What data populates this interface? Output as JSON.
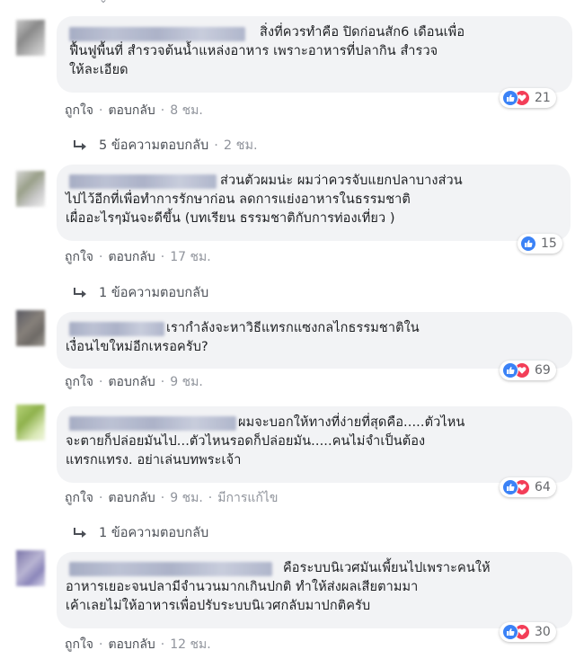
{
  "comments": [
    {
      "text": "สิ่งที่ควรทำคือ ปิดก่อนสัก6 เดือนเพื่อ\nฟื้นฟูพื้นที่ สำรวจต้นน้ำแหล่งอาหาร เพราะอาหารที่ปลากิน สำรวจ\nให้ละเอียด",
      "reaction_count": "21",
      "reactions": [
        "like",
        "love"
      ],
      "like_label": "ถูกใจ",
      "reply_label": "ตอบกลับ",
      "time": "8 ชม.",
      "replies_label": "5 ข้อความตอบกลับ",
      "replies_time": "2 ชม."
    },
    {
      "text": "ส่วนตัวผมน่ะ ผมว่าควรจับแยกปลาบางส่วน\nไปไว้อีกที่เพื่อทำการรักษาก่อน ลดการแย่งอาหารในธรรมชาติ\nเผื่ออะไรๆมันจะดีขึ้น (บทเรียน ธรรมชาติกับการท่องเที่ยว )",
      "reaction_count": "15",
      "reactions": [
        "like"
      ],
      "like_label": "ถูกใจ",
      "reply_label": "ตอบกลับ",
      "time": "17 ชม.",
      "replies_label": "1 ข้อความตอบกลับ"
    },
    {
      "text": "เรากำลังจะหาวิธีแทรกแซงกลไกธรรมชาติใน\nเงื่อนไขใหม่อีกเหรอครับ?",
      "reaction_count": "69",
      "reactions": [
        "like",
        "love"
      ],
      "like_label": "ถูกใจ",
      "reply_label": "ตอบกลับ",
      "time": "9 ชม."
    },
    {
      "text": "ผมจะบอกให้ทางที่ง่ายที่สุดคือ.....ตัวไหน\nจะตายก็ปล่อยมันไป...ตัวไหนรอดก็ปล่อยมัน.....คนไม่จำเป็นต้อง\nแทรกแทรง. อย่าเล่นบทพระเจ้า",
      "reaction_count": "64",
      "reactions": [
        "like",
        "love"
      ],
      "like_label": "ถูกใจ",
      "reply_label": "ตอบกลับ",
      "time": "9 ชม.",
      "edited_label": "มีการแก้ไข",
      "replies_label": "1 ข้อความตอบกลับ"
    },
    {
      "text": "คือระบบนิเวศมันเพี้ยนไปเพราะคนให้\nอาหารเยอะจนปลามีจำนวนมากเกินปกติ ทำให้ส่งผลเสียตามมา\nเค้าเลยไม่ให้อาหารเพื่อปรับระบบนิเวศกลับมาปกติครับ",
      "reaction_count": "30",
      "reactions": [
        "like",
        "love"
      ],
      "like_label": "ถูกใจ",
      "reply_label": "ตอบกลับ",
      "time": "12 ชม."
    }
  ],
  "colors": {
    "like_blue": "#3b82f6",
    "love_red": "#f33e58",
    "bubble_bg": "#f2f3f5",
    "meta_text": "#606770"
  },
  "icons": {
    "like": "thumbs-up-icon",
    "love": "heart-icon",
    "reply": "reply-arrow-icon"
  }
}
